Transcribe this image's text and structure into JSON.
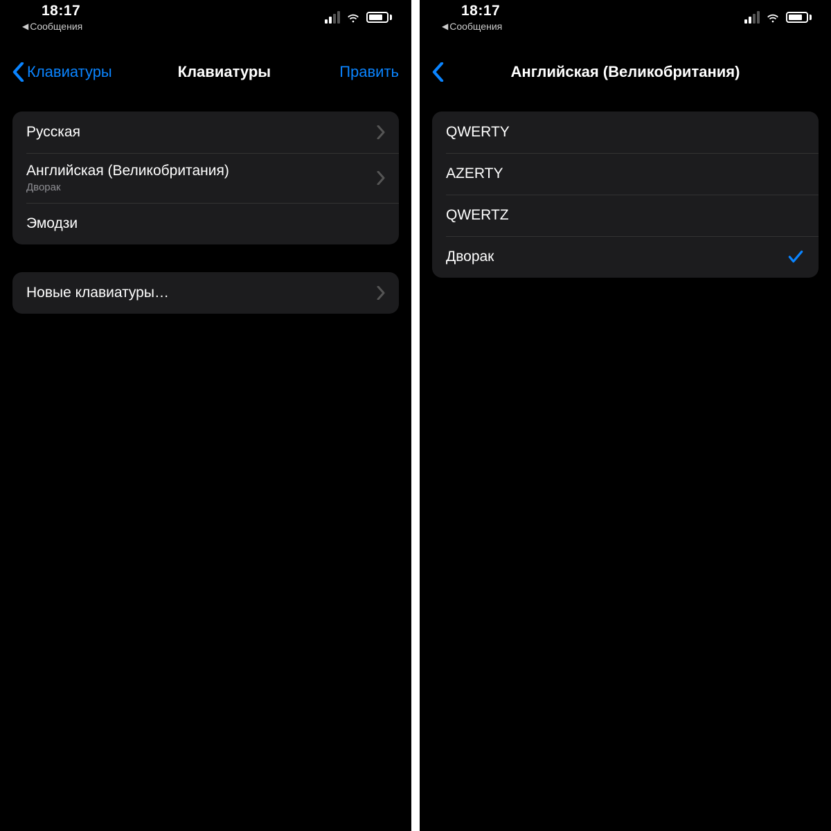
{
  "left": {
    "status": {
      "time": "18:17",
      "breadcrumb": "Сообщения"
    },
    "nav": {
      "back": "Клавиатуры",
      "title": "Клавиатуры",
      "edit": "Править"
    },
    "keyboards": [
      {
        "title": "Русская",
        "sub": "",
        "chevron": true
      },
      {
        "title": "Английская (Великобритания)",
        "sub": "Дворак",
        "chevron": true
      },
      {
        "title": "Эмодзи",
        "sub": "",
        "chevron": false
      }
    ],
    "newKeyboards": {
      "title": "Новые клавиатуры…",
      "chevron": true
    }
  },
  "right": {
    "status": {
      "time": "18:17",
      "breadcrumb": "Сообщения"
    },
    "nav": {
      "title": "Английская (Великобритания)"
    },
    "layouts": [
      {
        "title": "QWERTY",
        "selected": false
      },
      {
        "title": "AZERTY",
        "selected": false
      },
      {
        "title": "QWERTZ",
        "selected": false
      },
      {
        "title": "Дворак",
        "selected": true
      }
    ]
  }
}
